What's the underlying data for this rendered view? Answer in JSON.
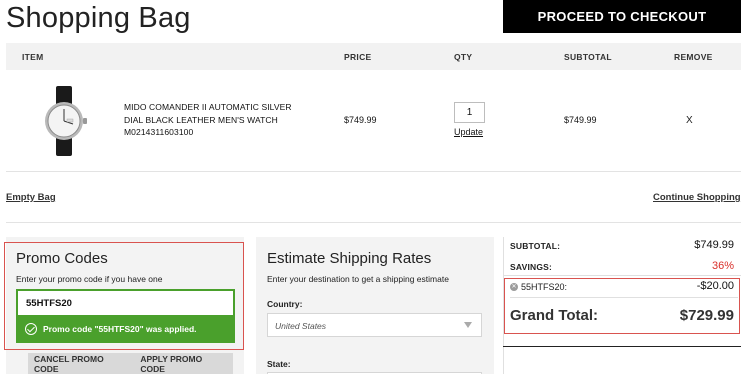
{
  "page": {
    "title": "Shopping Bag",
    "checkout_label": "PROCEED TO CHECKOUT"
  },
  "table": {
    "headers": {
      "item": "ITEM",
      "price": "PRICE",
      "qty": "QTY",
      "subtotal": "SUBTOTAL",
      "remove": "REMOVE"
    },
    "rows": [
      {
        "name": "MIDO COMANDER II AUTOMATIC SILVER DIAL BLACK LEATHER MEN'S WATCH M0214311603100",
        "price": "$749.99",
        "qty": "1",
        "update_label": "Update",
        "subtotal": "$749.99",
        "remove_label": "X"
      }
    ]
  },
  "links": {
    "empty_bag": "Empty Bag",
    "continue_shopping": "Continue Shopping"
  },
  "promo": {
    "title": "Promo Codes",
    "hint": "Enter your promo code if you have one",
    "input_value": "55HTFS20",
    "success_message": "Promo code \"55HTFS20\" was applied.",
    "cancel_label": "CANCEL PROMO CODE",
    "apply_label": "APPLY PROMO CODE",
    "success_color": "#4aa02c"
  },
  "shipping": {
    "title": "Estimate Shipping Rates",
    "hint": "Enter your destination to get a shipping estimate",
    "country_label": "Country:",
    "country_value": "United States",
    "state_label": "State:"
  },
  "totals": {
    "subtotal_label": "SUBTOTAL:",
    "subtotal_value": "$749.99",
    "savings_label": "SAVINGS:",
    "savings_value": "36%",
    "promo_code": "55HTFS20:",
    "promo_discount": "-$20.00",
    "grand_total_label": "Grand Total:",
    "grand_total_value": "$729.99",
    "savings_color": "#d9302b",
    "highlight_color": "#d9534f"
  }
}
